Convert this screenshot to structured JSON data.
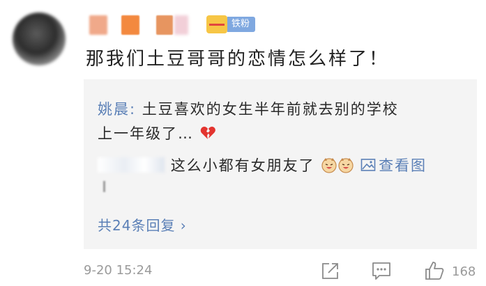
{
  "comment": {
    "badge_label": "铁粉",
    "text": "那我们土豆哥哥的恋情怎么样了！"
  },
  "replies": {
    "reply1_name": "姚晨:",
    "reply1_text_line1": "土豆喜欢的女生半年前就去别的学校",
    "reply1_text_line2": "上一年级了…",
    "reply2_text": "这么小都有女朋友了",
    "view_image_label": "查看图",
    "total_label": "共24条回复 ›"
  },
  "footer": {
    "timestamp": "9-20 15:24",
    "like_count": "168"
  },
  "icons": [
    "broken-heart-icon",
    "laughing-face-icon",
    "image-icon",
    "share-icon",
    "comment-icon",
    "thumbs-up-icon"
  ],
  "colors": {
    "link": "#5a7fb6",
    "reply_bg": "#f4f4f4",
    "meta": "#9a9a9a",
    "badge": "#7fa8e0"
  }
}
